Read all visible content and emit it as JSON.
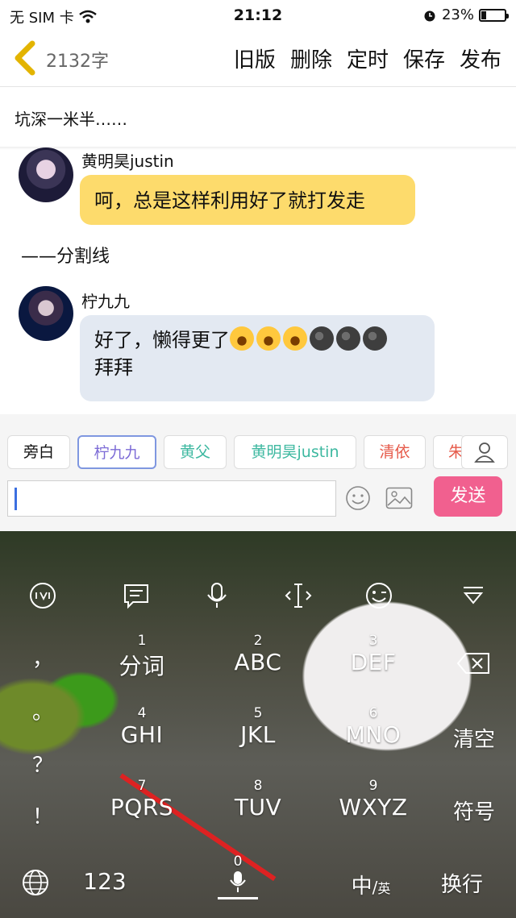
{
  "status": {
    "carrier": "无 SIM 卡",
    "time": "21:12",
    "battery": "23%",
    "battery_level": 0.23
  },
  "header": {
    "word_count": "2132字",
    "actions": [
      "旧版",
      "删除",
      "定时",
      "保存",
      "发布"
    ]
  },
  "scene_text": "坑深一米半……",
  "messages": [
    {
      "name": "黄明昊justin",
      "text": "呵，总是这样利用好了就打发走"
    },
    {
      "name": "柠九九",
      "line1": "好了，懒得更了",
      "line2": "拜拜"
    }
  ],
  "separator": "——分割线",
  "roles": [
    "旁白",
    "柠九九",
    "黄父",
    "黄明昊justin",
    "清依",
    "朱"
  ],
  "input": {
    "value": ""
  },
  "send_label": "发送",
  "keyboard": {
    "punct": [
      "，",
      "。",
      "？",
      "！"
    ],
    "keys": [
      {
        "num": "1",
        "label": "分词"
      },
      {
        "num": "2",
        "label": "ABC"
      },
      {
        "num": "3",
        "label": "DEF"
      },
      {
        "num": "4",
        "label": "GHI"
      },
      {
        "num": "5",
        "label": "JKL"
      },
      {
        "num": "6",
        "label": "MNO"
      },
      {
        "num": "7",
        "label": "PQRS"
      },
      {
        "num": "8",
        "label": "TUV"
      },
      {
        "num": "9",
        "label": "WXYZ"
      }
    ],
    "clear": "清空",
    "symbols": "符号",
    "num_key": "123",
    "space_num": "0",
    "lang": "中",
    "lang_sub": "英",
    "enter": "换行"
  },
  "colors": {
    "bubble_self": "#fddb6c",
    "bubble_other": "#e3e9f2",
    "send": "#f1608f",
    "accent": "#e3b400"
  }
}
